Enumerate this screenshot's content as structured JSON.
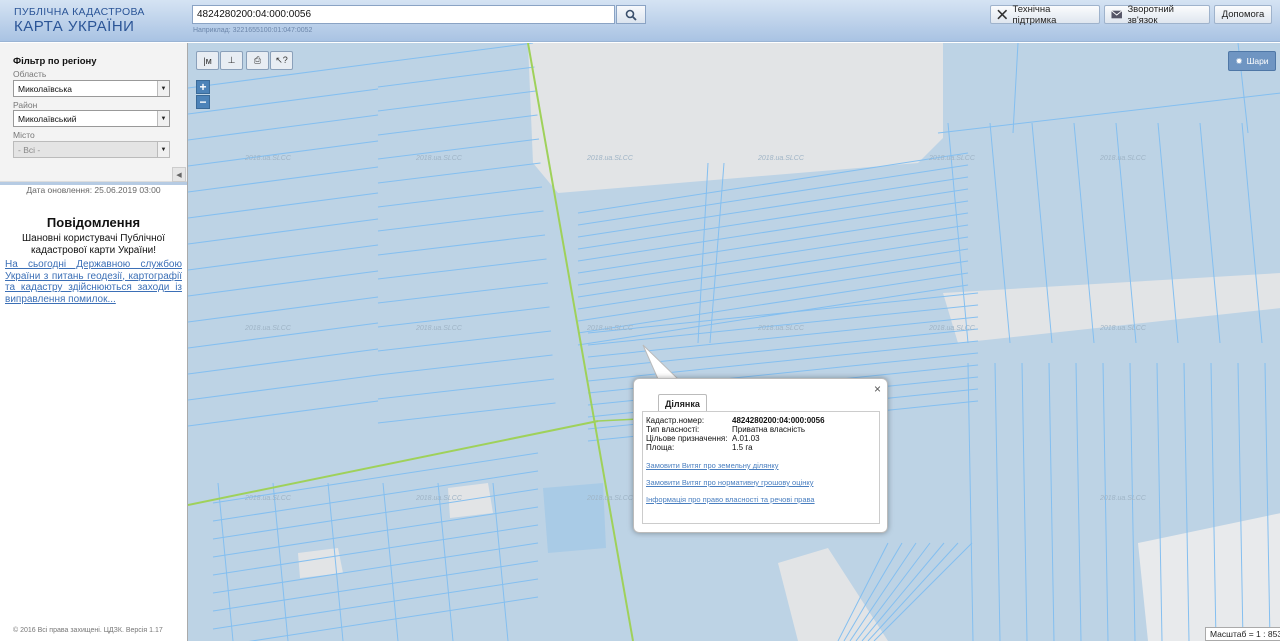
{
  "header": {
    "logo_line1": "ПУБЛІЧНА КАДАСТРОВА",
    "logo_line2": "КАРТА УКРАЇНИ",
    "search_value": "4824280200:04:000:0056",
    "search_hint": "Наприклад: 3221655100:01:047:0052",
    "support_label": "Технічна підтримка",
    "feedback_label": "Зворотний зв'язок",
    "help_label": "Допомога"
  },
  "sidebar": {
    "filter_title": "Фільтр по регіону",
    "oblast_label": "Область",
    "oblast_value": "Миколаївська",
    "rayon_label": "Район",
    "rayon_value": "Миколаївський",
    "city_label": "Місто",
    "city_value": "- Всі -",
    "update_date": "Дата оновлення: 25.06.2019 03:00",
    "notice_title": "Повідомлення",
    "notice_text": "Шановні користувачі Публічної кадастрової карти України!",
    "notice_link": "На сьогодні Державною службою України з питань геодезії, картографії та кадастру здійснюються заходи із виправлення помилок...",
    "copyright": "© 2016 Всі права захищені. ЦДЗК. Версія 1.17"
  },
  "map": {
    "layers_label": "Шари",
    "watermark": "2018.ua.SLCC",
    "scale_text": "Масштаб = 1 : 8531",
    "background_color": "#bdd3e5",
    "parcel_line_color": "#84bff0",
    "road_color": "#9fd15a"
  },
  "popup": {
    "tab_label": "Ділянка",
    "fields": [
      {
        "key": "Кадастр.номер:",
        "value": "4824280200:04:000:0056"
      },
      {
        "key": "Тип власності:",
        "value": "Приватна власність"
      },
      {
        "key": "Цільове призначення:",
        "value": "A.01.03"
      },
      {
        "key": "Площа:",
        "value": "1.5 га"
      }
    ],
    "links": [
      "Замовити Витяг про земельну ділянку",
      "Замовити Витяг про нормативну грошову оцінку",
      "Інформація про право власності та речові права"
    ]
  }
}
